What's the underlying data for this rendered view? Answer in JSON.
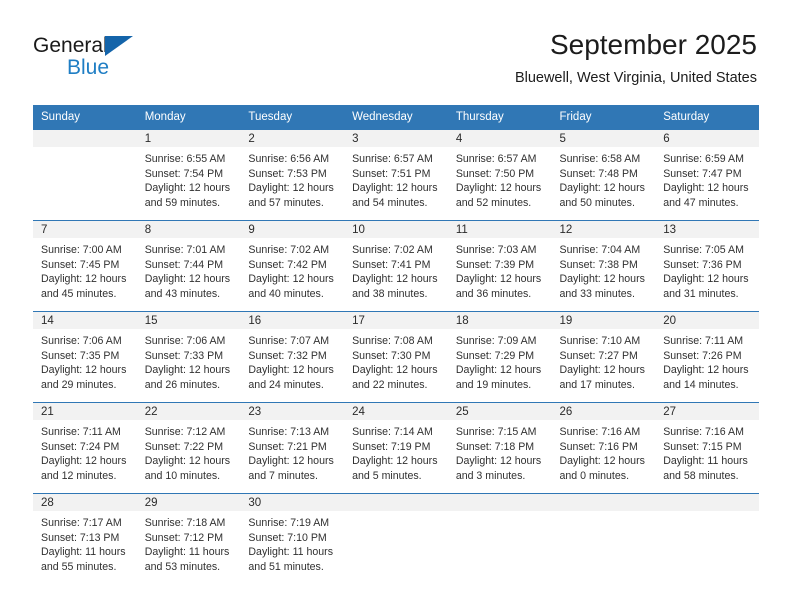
{
  "brand": {
    "name_top": "General",
    "name_bottom": "Blue",
    "triangle_color": "#1464aa",
    "blue_text_color": "#1f7ec4"
  },
  "header": {
    "title": "September 2025",
    "subtitle": "Bluewell, West Virginia, United States",
    "header_bg": "#3077b5"
  },
  "weekday_headers": [
    "Sunday",
    "Monday",
    "Tuesday",
    "Wednesday",
    "Thursday",
    "Friday",
    "Saturday"
  ],
  "labels": {
    "sunrise_prefix": "Sunrise:",
    "sunset_prefix": "Sunset:",
    "daylight_prefix": "Daylight:"
  },
  "weeks": [
    [
      {
        "day": "",
        "line1": "",
        "line2": "",
        "line3": "",
        "line4": ""
      },
      {
        "day": "1",
        "line1": "Sunrise: 6:55 AM",
        "line2": "Sunset: 7:54 PM",
        "line3": "Daylight: 12 hours",
        "line4": "and 59 minutes."
      },
      {
        "day": "2",
        "line1": "Sunrise: 6:56 AM",
        "line2": "Sunset: 7:53 PM",
        "line3": "Daylight: 12 hours",
        "line4": "and 57 minutes."
      },
      {
        "day": "3",
        "line1": "Sunrise: 6:57 AM",
        "line2": "Sunset: 7:51 PM",
        "line3": "Daylight: 12 hours",
        "line4": "and 54 minutes."
      },
      {
        "day": "4",
        "line1": "Sunrise: 6:57 AM",
        "line2": "Sunset: 7:50 PM",
        "line3": "Daylight: 12 hours",
        "line4": "and 52 minutes."
      },
      {
        "day": "5",
        "line1": "Sunrise: 6:58 AM",
        "line2": "Sunset: 7:48 PM",
        "line3": "Daylight: 12 hours",
        "line4": "and 50 minutes."
      },
      {
        "day": "6",
        "line1": "Sunrise: 6:59 AM",
        "line2": "Sunset: 7:47 PM",
        "line3": "Daylight: 12 hours",
        "line4": "and 47 minutes."
      }
    ],
    [
      {
        "day": "7",
        "line1": "Sunrise: 7:00 AM",
        "line2": "Sunset: 7:45 PM",
        "line3": "Daylight: 12 hours",
        "line4": "and 45 minutes."
      },
      {
        "day": "8",
        "line1": "Sunrise: 7:01 AM",
        "line2": "Sunset: 7:44 PM",
        "line3": "Daylight: 12 hours",
        "line4": "and 43 minutes."
      },
      {
        "day": "9",
        "line1": "Sunrise: 7:02 AM",
        "line2": "Sunset: 7:42 PM",
        "line3": "Daylight: 12 hours",
        "line4": "and 40 minutes."
      },
      {
        "day": "10",
        "line1": "Sunrise: 7:02 AM",
        "line2": "Sunset: 7:41 PM",
        "line3": "Daylight: 12 hours",
        "line4": "and 38 minutes."
      },
      {
        "day": "11",
        "line1": "Sunrise: 7:03 AM",
        "line2": "Sunset: 7:39 PM",
        "line3": "Daylight: 12 hours",
        "line4": "and 36 minutes."
      },
      {
        "day": "12",
        "line1": "Sunrise: 7:04 AM",
        "line2": "Sunset: 7:38 PM",
        "line3": "Daylight: 12 hours",
        "line4": "and 33 minutes."
      },
      {
        "day": "13",
        "line1": "Sunrise: 7:05 AM",
        "line2": "Sunset: 7:36 PM",
        "line3": "Daylight: 12 hours",
        "line4": "and 31 minutes."
      }
    ],
    [
      {
        "day": "14",
        "line1": "Sunrise: 7:06 AM",
        "line2": "Sunset: 7:35 PM",
        "line3": "Daylight: 12 hours",
        "line4": "and 29 minutes."
      },
      {
        "day": "15",
        "line1": "Sunrise: 7:06 AM",
        "line2": "Sunset: 7:33 PM",
        "line3": "Daylight: 12 hours",
        "line4": "and 26 minutes."
      },
      {
        "day": "16",
        "line1": "Sunrise: 7:07 AM",
        "line2": "Sunset: 7:32 PM",
        "line3": "Daylight: 12 hours",
        "line4": "and 24 minutes."
      },
      {
        "day": "17",
        "line1": "Sunrise: 7:08 AM",
        "line2": "Sunset: 7:30 PM",
        "line3": "Daylight: 12 hours",
        "line4": "and 22 minutes."
      },
      {
        "day": "18",
        "line1": "Sunrise: 7:09 AM",
        "line2": "Sunset: 7:29 PM",
        "line3": "Daylight: 12 hours",
        "line4": "and 19 minutes."
      },
      {
        "day": "19",
        "line1": "Sunrise: 7:10 AM",
        "line2": "Sunset: 7:27 PM",
        "line3": "Daylight: 12 hours",
        "line4": "and 17 minutes."
      },
      {
        "day": "20",
        "line1": "Sunrise: 7:11 AM",
        "line2": "Sunset: 7:26 PM",
        "line3": "Daylight: 12 hours",
        "line4": "and 14 minutes."
      }
    ],
    [
      {
        "day": "21",
        "line1": "Sunrise: 7:11 AM",
        "line2": "Sunset: 7:24 PM",
        "line3": "Daylight: 12 hours",
        "line4": "and 12 minutes."
      },
      {
        "day": "22",
        "line1": "Sunrise: 7:12 AM",
        "line2": "Sunset: 7:22 PM",
        "line3": "Daylight: 12 hours",
        "line4": "and 10 minutes."
      },
      {
        "day": "23",
        "line1": "Sunrise: 7:13 AM",
        "line2": "Sunset: 7:21 PM",
        "line3": "Daylight: 12 hours",
        "line4": "and 7 minutes."
      },
      {
        "day": "24",
        "line1": "Sunrise: 7:14 AM",
        "line2": "Sunset: 7:19 PM",
        "line3": "Daylight: 12 hours",
        "line4": "and 5 minutes."
      },
      {
        "day": "25",
        "line1": "Sunrise: 7:15 AM",
        "line2": "Sunset: 7:18 PM",
        "line3": "Daylight: 12 hours",
        "line4": "and 3 minutes."
      },
      {
        "day": "26",
        "line1": "Sunrise: 7:16 AM",
        "line2": "Sunset: 7:16 PM",
        "line3": "Daylight: 12 hours",
        "line4": "and 0 minutes."
      },
      {
        "day": "27",
        "line1": "Sunrise: 7:16 AM",
        "line2": "Sunset: 7:15 PM",
        "line3": "Daylight: 11 hours",
        "line4": "and 58 minutes."
      }
    ],
    [
      {
        "day": "28",
        "line1": "Sunrise: 7:17 AM",
        "line2": "Sunset: 7:13 PM",
        "line3": "Daylight: 11 hours",
        "line4": "and 55 minutes."
      },
      {
        "day": "29",
        "line1": "Sunrise: 7:18 AM",
        "line2": "Sunset: 7:12 PM",
        "line3": "Daylight: 11 hours",
        "line4": "and 53 minutes."
      },
      {
        "day": "30",
        "line1": "Sunrise: 7:19 AM",
        "line2": "Sunset: 7:10 PM",
        "line3": "Daylight: 11 hours",
        "line4": "and 51 minutes."
      },
      {
        "day": "",
        "line1": "",
        "line2": "",
        "line3": "",
        "line4": ""
      },
      {
        "day": "",
        "line1": "",
        "line2": "",
        "line3": "",
        "line4": ""
      },
      {
        "day": "",
        "line1": "",
        "line2": "",
        "line3": "",
        "line4": ""
      },
      {
        "day": "",
        "line1": "",
        "line2": "",
        "line3": "",
        "line4": ""
      }
    ]
  ]
}
